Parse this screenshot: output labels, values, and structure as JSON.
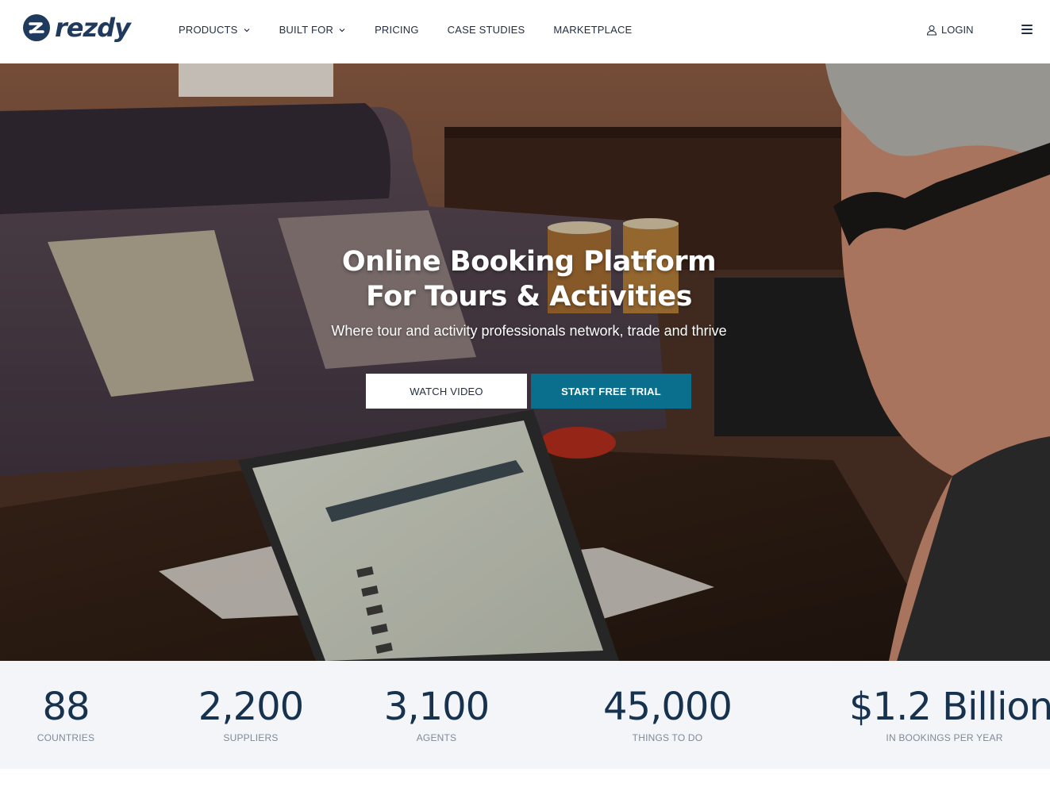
{
  "brand": {
    "name": "rezdy",
    "primary_color": "#1f3a5c",
    "accent_color": "#0a6f8c"
  },
  "nav": {
    "items": [
      {
        "label": "PRODUCTS",
        "has_dropdown": true
      },
      {
        "label": "BUILT FOR",
        "has_dropdown": true
      },
      {
        "label": "PRICING",
        "has_dropdown": false
      },
      {
        "label": "CASE STUDIES",
        "has_dropdown": false
      },
      {
        "label": "MARKETPLACE",
        "has_dropdown": false
      }
    ],
    "login_label": "LOGIN",
    "login_icon": "user-icon",
    "menu_icon": "hamburger-icon"
  },
  "hero": {
    "title_line1": "Online Booking Platform",
    "title_line2": "For Tours & Activities",
    "subtitle": "Where tour and activity professionals network, trade and thrive",
    "watch_video_label": "WATCH VIDEO",
    "start_trial_label": "START FREE TRIAL"
  },
  "stats": [
    {
      "value": "88",
      "label": "COUNTRIES"
    },
    {
      "value": "2,200",
      "label": "SUPPLIERS"
    },
    {
      "value": "3,100",
      "label": "AGENTS"
    },
    {
      "value": "45,000",
      "label": "THINGS TO DO"
    },
    {
      "value": "$1.2 Billion",
      "label": "IN BOOKINGS PER YEAR"
    }
  ]
}
